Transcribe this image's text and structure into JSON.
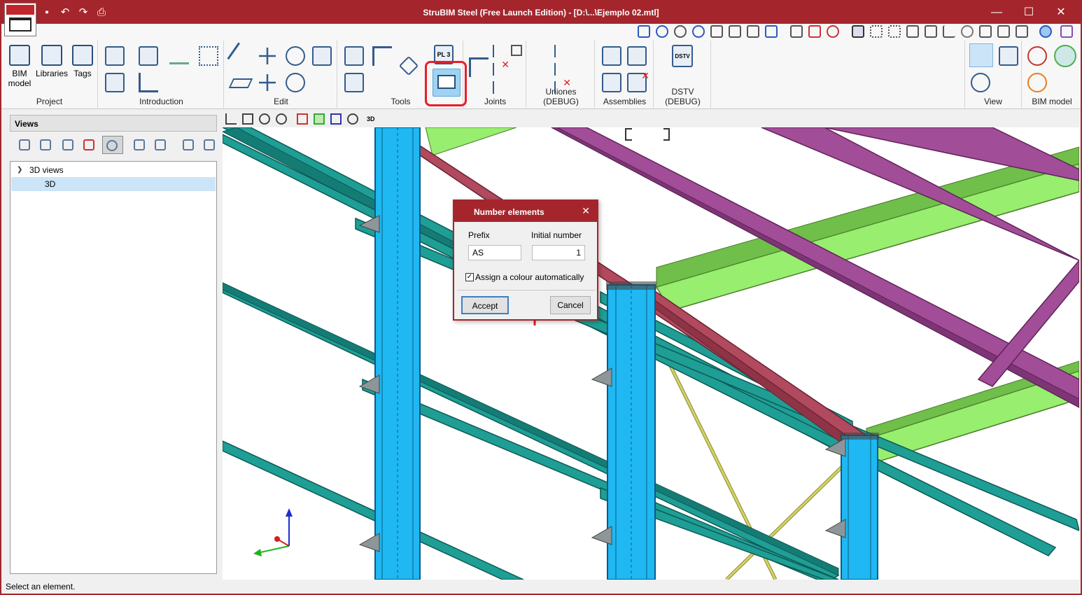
{
  "window": {
    "title": "StruBIM Steel (Free Launch Edition) - [D:\\...\\Ejemplo 02.mtl]"
  },
  "quick_access": [
    "save-icon",
    "undo-icon",
    "redo-icon",
    "print-icon"
  ],
  "ribbon": {
    "groups": {
      "project": "Project",
      "introduction": "Introduction",
      "edit": "Edit",
      "tools": "Tools",
      "joints": "Joints",
      "uniones_debug": "Uniones (DEBUG)",
      "assemblies": "Assemblies",
      "dstv_debug": "DSTV (DEBUG)",
      "view": "View",
      "bim_model": "BIM model"
    },
    "buttons": {
      "bim_model": "BIM\nmodel",
      "libraries": "Libraries",
      "tags": "Tags",
      "pl3": "PL 3",
      "dstv": "DSTV"
    }
  },
  "views_panel": {
    "header": "Views",
    "tree": {
      "group": "3D views",
      "item": "3D"
    }
  },
  "viewport_toolbar": {
    "label_3d": "3D"
  },
  "dialog": {
    "title": "Number elements",
    "prefix_label": "Prefix",
    "prefix_value": "AS",
    "initial_label": "Initial number",
    "initial_value": "1",
    "assign_color_label": "Assign a colour automatically",
    "assign_color_checked": "✓",
    "accept": "Accept",
    "cancel": "Cancel"
  },
  "status": {
    "text": "Select an element."
  },
  "colors": {
    "accent": "#a4262c",
    "column": "#1fb8f2",
    "purlin": "#1f9e95",
    "rafter_purple": "#a24d98",
    "beam_green": "#97ee6f",
    "beam_red": "#b14a5e",
    "brace_yellow": "#d2d266",
    "highlight": "#e51f2a"
  }
}
